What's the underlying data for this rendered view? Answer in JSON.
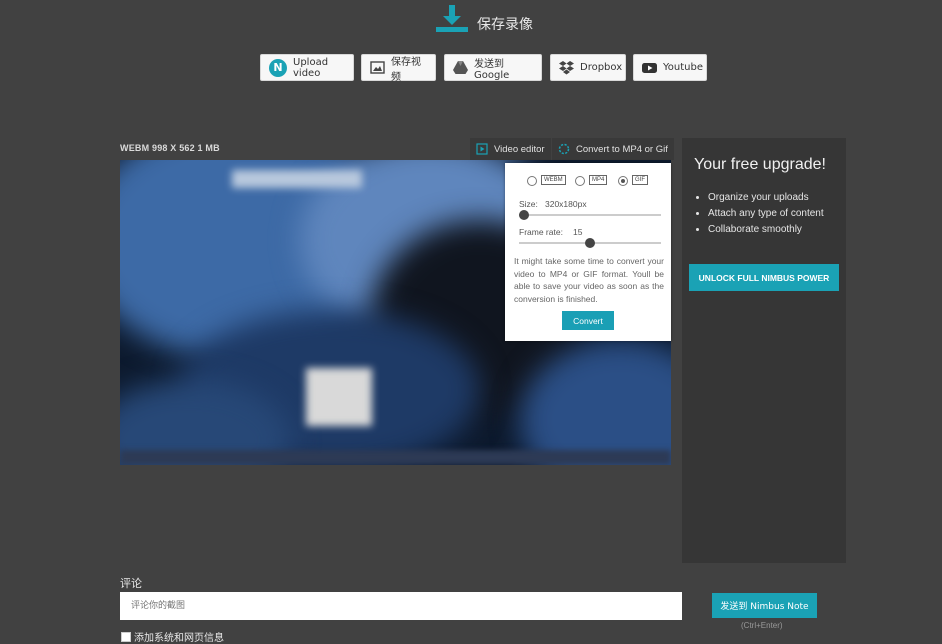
{
  "header": {
    "title": "保存录像",
    "icon": "download-icon"
  },
  "share_buttons": [
    {
      "label": "Upload video",
      "icon": "nimbus-icon"
    },
    {
      "label": "保存视频",
      "icon": "image-icon"
    },
    {
      "label": "发送到 Google",
      "icon": "google-drive-icon"
    },
    {
      "label": "Dropbox",
      "icon": "dropbox-icon"
    },
    {
      "label": "Youtube",
      "icon": "youtube-icon"
    }
  ],
  "video": {
    "meta": "WEBM 998 X 562 1 MB"
  },
  "toolbar": {
    "video_editor": "Video editor",
    "convert": "Convert to MP4 or Gif"
  },
  "convert_popup": {
    "formats": [
      "WEBM",
      "MP4",
      "GIF"
    ],
    "selected_format": "GIF",
    "size_label": "Size:",
    "size_value": "320x180px",
    "size_level": 0,
    "frame_rate_label": "Frame rate:",
    "frame_rate_value": "15",
    "frame_rate_level": 0.5,
    "info": "It might take some time to convert your video to MP4 or GIF format. Youll be able to save your video as soon as the conversion is finished.",
    "button": "Convert"
  },
  "upgrade": {
    "title": "Your free upgrade!",
    "items": [
      "Organize your uploads",
      "Attach any type of content",
      "Collaborate smoothly"
    ],
    "button": "UNLOCK FULL NIMBUS POWER"
  },
  "comment": {
    "label": "评论",
    "placeholder": "评论你的截图",
    "send_button": "发送到 Nimbus Note",
    "send_hint": "(Ctrl+Enter)",
    "checkbox_label": "添加系统和网页信息"
  },
  "colors": {
    "accent": "#1aa2b5",
    "background": "#414141",
    "panel": "#363636"
  }
}
